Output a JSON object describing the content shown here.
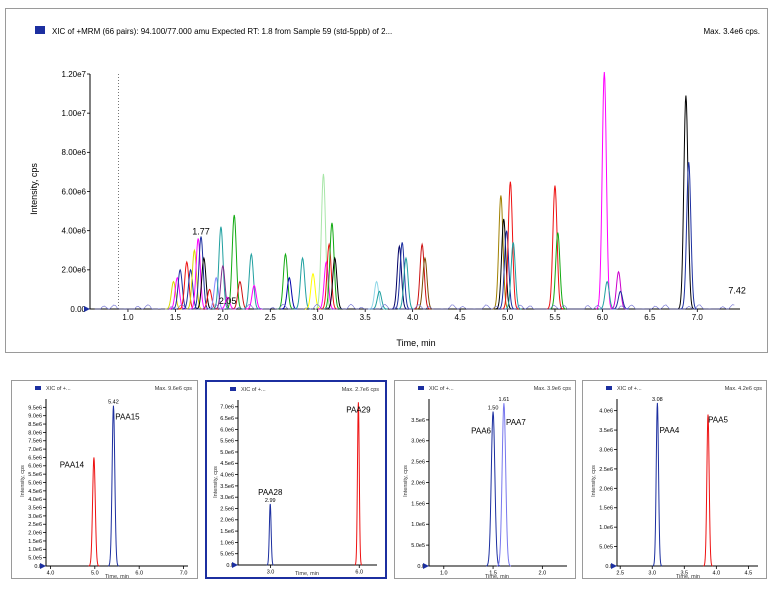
{
  "main": {
    "header_text": "XIC of +MRM (66 pairs): 94.100/77.000 amu Expected RT: 1.8  from Sample 59 (std-5ppb) of 2...",
    "max_text": "Max. 3.4e6 cps.",
    "legend_color": "#1c2fa0"
  },
  "chart_data": [
    {
      "type": "line",
      "xlabel": "Time, min",
      "ylabel": "Intensity, cps",
      "xlim": [
        0.6,
        7.45
      ],
      "ylim": [
        0,
        12000000
      ],
      "x_ticks": [
        "1.0",
        "1.5",
        "2.0",
        "2.5",
        "3.0",
        "3.5",
        "4.0",
        "4.5",
        "5.0",
        "5.5",
        "6.0",
        "6.5",
        "7.0"
      ],
      "x_tick_values": [
        1.0,
        1.5,
        2.0,
        2.5,
        3.0,
        3.5,
        4.0,
        4.5,
        5.0,
        5.5,
        6.0,
        6.5,
        7.0
      ],
      "y_ticks": [
        "0.00",
        "2.00e6",
        "4.00e6",
        "6.00e6",
        "8.00e6",
        "1.00e7",
        "1.20e7"
      ],
      "y_tick_values": [
        0,
        2000000,
        4000000,
        6000000,
        8000000,
        10000000,
        12000000
      ],
      "annotations": [
        {
          "text": "1.77",
          "x": 1.77,
          "y": 3800000
        },
        {
          "text": "2.05",
          "x": 2.05,
          "y": 250000
        },
        {
          "text": "7.42",
          "x": 7.42,
          "y": 800000
        }
      ],
      "peaks": [
        {
          "x": 1.48,
          "y": 1400000,
          "color": "#d9d900"
        },
        {
          "x": 1.52,
          "y": 1600000,
          "color": "#ff00ff"
        },
        {
          "x": 1.55,
          "y": 2000000,
          "color": "#1c2fa0"
        },
        {
          "x": 1.62,
          "y": 2400000,
          "color": "#ee1111"
        },
        {
          "x": 1.66,
          "y": 2000000,
          "color": "#1c2fa0"
        },
        {
          "x": 1.7,
          "y": 3000000,
          "color": "#d9d900"
        },
        {
          "x": 1.74,
          "y": 3600000,
          "color": "#ff00ff"
        },
        {
          "x": 1.77,
          "y": 3700000,
          "color": "#1c2fa0"
        },
        {
          "x": 1.8,
          "y": 2600000,
          "color": "#000000"
        },
        {
          "x": 1.86,
          "y": 1000000,
          "color": "#ee1111"
        },
        {
          "x": 1.93,
          "y": 1600000,
          "color": "#8888ff"
        },
        {
          "x": 1.98,
          "y": 4200000,
          "color": "#20a0a0"
        },
        {
          "x": 2.0,
          "y": 2200000,
          "color": "#7b2d8b"
        },
        {
          "x": 2.05,
          "y": 600000,
          "color": "#ff00ff"
        },
        {
          "x": 2.12,
          "y": 4800000,
          "color": "#11aa11"
        },
        {
          "x": 2.18,
          "y": 1400000,
          "color": "#cc1111"
        },
        {
          "x": 2.3,
          "y": 2800000,
          "color": "#20a0a0"
        },
        {
          "x": 2.33,
          "y": 1200000,
          "color": "#ff00ff"
        },
        {
          "x": 2.66,
          "y": 2800000,
          "color": "#11aa11"
        },
        {
          "x": 2.7,
          "y": 1600000,
          "color": "#0000aa"
        },
        {
          "x": 2.84,
          "y": 2600000,
          "color": "#20a0a0"
        },
        {
          "x": 2.95,
          "y": 1800000,
          "color": "#ffff00"
        },
        {
          "x": 3.06,
          "y": 6900000,
          "color": "#a8e6a8"
        },
        {
          "x": 3.09,
          "y": 2400000,
          "color": "#ff00ff"
        },
        {
          "x": 3.12,
          "y": 3300000,
          "color": "#ee1111"
        },
        {
          "x": 3.15,
          "y": 4400000,
          "color": "#11aa11"
        },
        {
          "x": 3.18,
          "y": 2600000,
          "color": "#000000"
        },
        {
          "x": 3.62,
          "y": 1400000,
          "color": "#8ed6e6"
        },
        {
          "x": 3.65,
          "y": 900000,
          "color": "#20a0a0"
        },
        {
          "x": 3.86,
          "y": 3200000,
          "color": "#000066"
        },
        {
          "x": 3.89,
          "y": 3400000,
          "color": "#1c2fa0"
        },
        {
          "x": 3.93,
          "y": 2600000,
          "color": "#20a0a0"
        },
        {
          "x": 4.1,
          "y": 3300000,
          "color": "#cc1111"
        },
        {
          "x": 4.13,
          "y": 2600000,
          "color": "#7a4a00"
        },
        {
          "x": 4.93,
          "y": 5800000,
          "color": "#a08000"
        },
        {
          "x": 4.96,
          "y": 4600000,
          "color": "#000000"
        },
        {
          "x": 4.99,
          "y": 4000000,
          "color": "#1c2fa0"
        },
        {
          "x": 5.03,
          "y": 6500000,
          "color": "#ee1111"
        },
        {
          "x": 5.06,
          "y": 3400000,
          "color": "#20a0a0"
        },
        {
          "x": 5.5,
          "y": 6300000,
          "color": "#ee1111"
        },
        {
          "x": 5.53,
          "y": 3900000,
          "color": "#11aa11"
        },
        {
          "x": 6.02,
          "y": 12100000,
          "color": "#ff00ff"
        },
        {
          "x": 6.05,
          "y": 1400000,
          "color": "#20a0a0"
        },
        {
          "x": 6.17,
          "y": 1900000,
          "color": "#cc00cc"
        },
        {
          "x": 6.19,
          "y": 900000,
          "color": "#1c2fa0"
        },
        {
          "x": 6.88,
          "y": 10900000,
          "color": "#000000"
        },
        {
          "x": 6.91,
          "y": 7500000,
          "color": "#1c2fa0"
        }
      ]
    },
    {
      "type": "line",
      "header_text": "XIC of +...",
      "max_text": "Max. 9.6e6 cps",
      "xlabel": "Time, min",
      "ylabel": "Intensity, cps",
      "xlim": [
        3.9,
        7.1
      ],
      "ylim": [
        0,
        10000000
      ],
      "x_ticks": [
        "4.0",
        "5.0",
        "6.0",
        "7.0"
      ],
      "x_tick_values": [
        4.0,
        5.0,
        6.0,
        7.0
      ],
      "y_ticks": [
        "0.0",
        "5.0e5",
        "1.0e6",
        "1.5e6",
        "2.0e6",
        "2.5e6",
        "3.0e6",
        "3.5e6",
        "4.0e6",
        "4.5e6",
        "5.0e6",
        "5.5e6",
        "6.0e6",
        "6.5e6",
        "7.0e6",
        "7.5e6",
        "8.0e6",
        "8.5e6",
        "9.0e6",
        "9.5e6"
      ],
      "y_tick_values": [
        0,
        500000,
        1000000,
        1500000,
        2000000,
        2500000,
        3000000,
        3500000,
        4000000,
        4500000,
        5000000,
        5500000,
        6000000,
        6500000,
        7000000,
        7500000,
        8000000,
        8500000,
        9000000,
        9500000
      ],
      "peaks": [
        {
          "x": 4.98,
          "y": 6500000,
          "color": "#ee1111",
          "label": "PAA14"
        },
        {
          "x": 5.42,
          "y": 9600000,
          "color": "#1c2fa0",
          "label": "PAA15",
          "rt": "5.42"
        }
      ]
    },
    {
      "type": "line",
      "header_text": "XIC of +...",
      "max_text": "Max. 2.7e6 cps",
      "xlabel": "Time, min",
      "ylabel": "Intensity, cps",
      "xlim": [
        1.9,
        6.6
      ],
      "ylim": [
        0,
        7300000
      ],
      "x_ticks": [
        "3.0",
        "6.0"
      ],
      "x_tick_values": [
        3.0,
        6.0
      ],
      "y_ticks": [
        "0.0",
        "5.0e5",
        "1.0e6",
        "1.5e6",
        "2.0e6",
        "2.5e6",
        "3.0e6",
        "3.5e6",
        "4.0e6",
        "4.5e6",
        "5.0e6",
        "5.5e6",
        "6.0e6",
        "6.5e6",
        "7.0e6"
      ],
      "y_tick_values": [
        0,
        500000,
        1000000,
        1500000,
        2000000,
        2500000,
        3000000,
        3500000,
        4000000,
        4500000,
        5000000,
        5500000,
        6000000,
        6500000,
        7000000
      ],
      "peaks": [
        {
          "x": 2.99,
          "y": 2700000,
          "color": "#1c2fa0",
          "label": "PAA28",
          "rt": "2.99"
        },
        {
          "x": 5.97,
          "y": 7200000,
          "color": "#ee1111",
          "label": "PAA29"
        }
      ]
    },
    {
      "type": "line",
      "header_text": "XIC of +...",
      "max_text": "Max. 3.9e6 cps",
      "xlabel": "Time, min",
      "ylabel": "Intensity, cps",
      "xlim": [
        0.85,
        2.25
      ],
      "ylim": [
        0,
        4000000
      ],
      "x_ticks": [
        "1.0",
        "1.5",
        "2.0"
      ],
      "x_tick_values": [
        1.0,
        1.5,
        2.0
      ],
      "y_ticks": [
        "0.0",
        "5.0e5",
        "1.0e6",
        "1.5e6",
        "2.0e6",
        "2.5e6",
        "3.0e6",
        "3.5e6"
      ],
      "y_tick_values": [
        0,
        500000,
        1000000,
        1500000,
        2000000,
        2500000,
        3000000,
        3500000
      ],
      "peaks": [
        {
          "x": 1.5,
          "y": 3700000,
          "color": "#1c2fa0",
          "label": "PAA6",
          "rt": "1.50"
        },
        {
          "x": 1.61,
          "y": 3900000,
          "color": "#7777ee",
          "label": "PAA7",
          "rt": "1.61"
        }
      ]
    },
    {
      "type": "line",
      "header_text": "XIC of +...",
      "max_text": "Max. 4.2e6 cps",
      "xlabel": "Time, min",
      "ylabel": "Intensity, cps",
      "xlim": [
        2.45,
        4.65
      ],
      "ylim": [
        0,
        4300000
      ],
      "x_ticks": [
        "2.5",
        "3.0",
        "3.5",
        "4.0",
        "4.5"
      ],
      "x_tick_values": [
        2.5,
        3.0,
        3.5,
        4.0,
        4.5
      ],
      "y_ticks": [
        "0.0",
        "5.0e5",
        "1.0e6",
        "1.5e6",
        "2.0e6",
        "2.5e6",
        "3.0e6",
        "3.5e6",
        "4.0e6"
      ],
      "y_tick_values": [
        0,
        500000,
        1000000,
        1500000,
        2000000,
        2500000,
        3000000,
        3500000,
        4000000
      ],
      "peaks": [
        {
          "x": 3.08,
          "y": 4200000,
          "color": "#1c2fa0",
          "label": "PAA4",
          "rt": "3.08"
        },
        {
          "x": 3.87,
          "y": 3900000,
          "color": "#ee1111",
          "label": "PAA5"
        }
      ]
    }
  ]
}
